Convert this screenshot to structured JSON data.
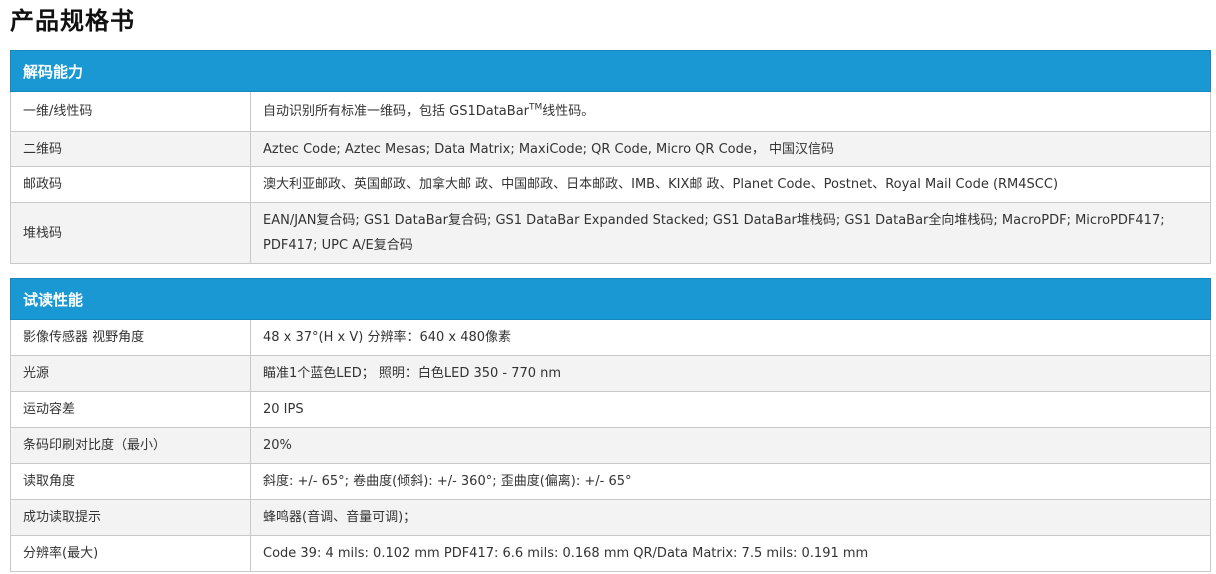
{
  "page": {
    "title": "产品规格书"
  },
  "decoding": {
    "header": "解码能力",
    "rows": [
      {
        "label": "一维/线性码",
        "value_pre": "自动识别所有标准一维码，包括 GS1DataBar",
        "value_sup": "TM",
        "value_post": "线性码。"
      },
      {
        "label": "二维码",
        "value": "Aztec Code; Aztec Mesas; Data Matrix; MaxiCode; QR Code, Micro QR Code， 中国汉信码"
      },
      {
        "label": "邮政码",
        "value": "澳大利亚邮政、英国邮政、加拿大邮 政、中国邮政、日本邮政、IMB、KIX邮 政、Planet Code、Postnet、Royal Mail Code (RM4SCC)"
      },
      {
        "label": "堆栈码",
        "value": "EAN/JAN复合码; GS1 DataBar复合码; GS1 DataBar Expanded Stacked; GS1 DataBar堆栈码; GS1 DataBar全向堆栈码; MacroPDF; MicroPDF417; PDF417; UPC A/E复合码"
      }
    ]
  },
  "reading": {
    "header": "试读性能",
    "rows": [
      {
        "label": "影像传感器 视野角度",
        "value": "48 x 37°(H x V) 分辨率：640 x 480像素"
      },
      {
        "label": "光源",
        "value": "瞄准1个蓝色LED； 照明：白色LED 350 - 770 nm"
      },
      {
        "label": "运动容差",
        "value": "20 IPS"
      },
      {
        "label": "条码印刷对比度（最小）",
        "value": "20%"
      },
      {
        "label": "读取角度",
        "value": "斜度: +/- 65°; 卷曲度(倾斜): +/- 360°; 歪曲度(偏离): +/- 65°"
      },
      {
        "label": "成功读取提示",
        "value": "蜂鸣器(音调、音量可调)；"
      },
      {
        "label": "分辨率(最大)",
        "value": "Code 39: 4 mils: 0.102 mm PDF417: 6.6 mils: 0.168 mm QR/Data Matrix: 7.5 mils: 0.191 mm"
      }
    ]
  },
  "colors": {
    "header_bg": "#1a98d4",
    "header_text": "#ffffff",
    "row_alt_bg": "#f3f3f3",
    "border": "#c9c9c9"
  }
}
